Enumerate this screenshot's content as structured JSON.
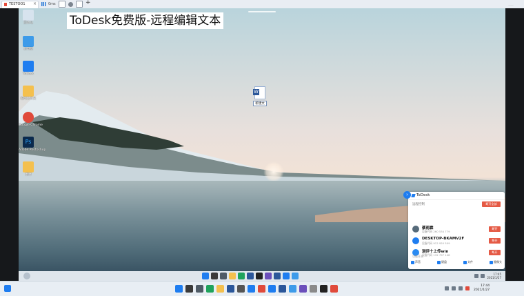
{
  "outer_tab": {
    "title": "TESTOO1",
    "close": "×"
  },
  "outer_controls": {
    "signal_label": "0ms",
    "new_tab": "+"
  },
  "minimize": "—",
  "banner": "ToDesk免费版-远程编辑文本",
  "desktop_icons": [
    {
      "id": "recycle-bin",
      "label": "回收站",
      "color": "#d7e3ee"
    },
    {
      "id": "this-pc",
      "label": "此电脑",
      "color": "#3d9be9"
    },
    {
      "id": "todesk",
      "label": "ToDesk",
      "color": "#1e7df0"
    },
    {
      "id": "folder",
      "label": "临时文件夹",
      "color": "#f4c04e"
    },
    {
      "id": "chrome",
      "label": "Google Chrome",
      "color": "#e04a3b"
    },
    {
      "id": "photoshop",
      "label": "Adobe Photoshop",
      "color": "#0b2a4d"
    },
    {
      "id": "folder2",
      "label": "素材",
      "color": "#f4c04e"
    }
  ],
  "word_file": {
    "icon": "W",
    "label": "新建文"
  },
  "remote_taskbar": {
    "clock_time": "17:45",
    "clock_date": "2021/1/27"
  },
  "todesk_panel": {
    "title": "ToDesk",
    "subtitle": "远程控制",
    "disconnect_all": "断开全部",
    "items": [
      {
        "name": "蔡雨霖",
        "id": "设备代码 260 534 779",
        "action": "断开",
        "avatar_color": "#566b7a"
      },
      {
        "name": "DESKTOP-BKAMV2F",
        "id": "设备代码 912 920 509",
        "action": "断开",
        "avatar_color": "#1e7df0"
      },
      {
        "name": "测评十上传win",
        "id": "设备代码 132 797 148",
        "action": "断开",
        "avatar_color": "#2a8bf2"
      }
    ],
    "footer_label": "功能开关",
    "footer": [
      "声音",
      "键盘",
      "文件",
      "摄像头"
    ]
  },
  "local_taskbar": {
    "clock_time": "17:44",
    "clock_date": "2021/1/27"
  }
}
